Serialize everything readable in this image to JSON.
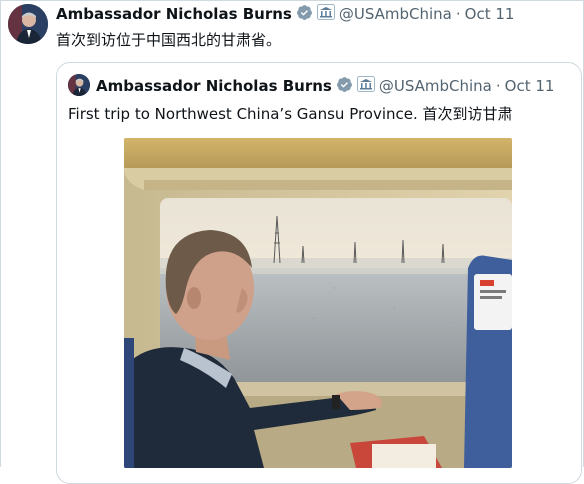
{
  "main_tweet": {
    "author_name": "Ambassador Nicholas Burns",
    "handle": "@USAmbChina",
    "separator": "·",
    "date": "Oct 11",
    "text": "首次到访位于中国西北的甘肃省。"
  },
  "quoted_tweet": {
    "author_name": "Ambassador Nicholas Burns",
    "handle": "@USAmbChina",
    "separator": "·",
    "date": "Oct 11",
    "text": "First trip to Northwest China’s Gansu Province. 首次到访甘肃"
  },
  "colors": {
    "text_primary": "#0f1419",
    "text_secondary": "#536471",
    "verified_badge": "#829aab",
    "border": "#cfd9de"
  },
  "icons": [
    "verified-badge-icon",
    "government-label-icon"
  ]
}
